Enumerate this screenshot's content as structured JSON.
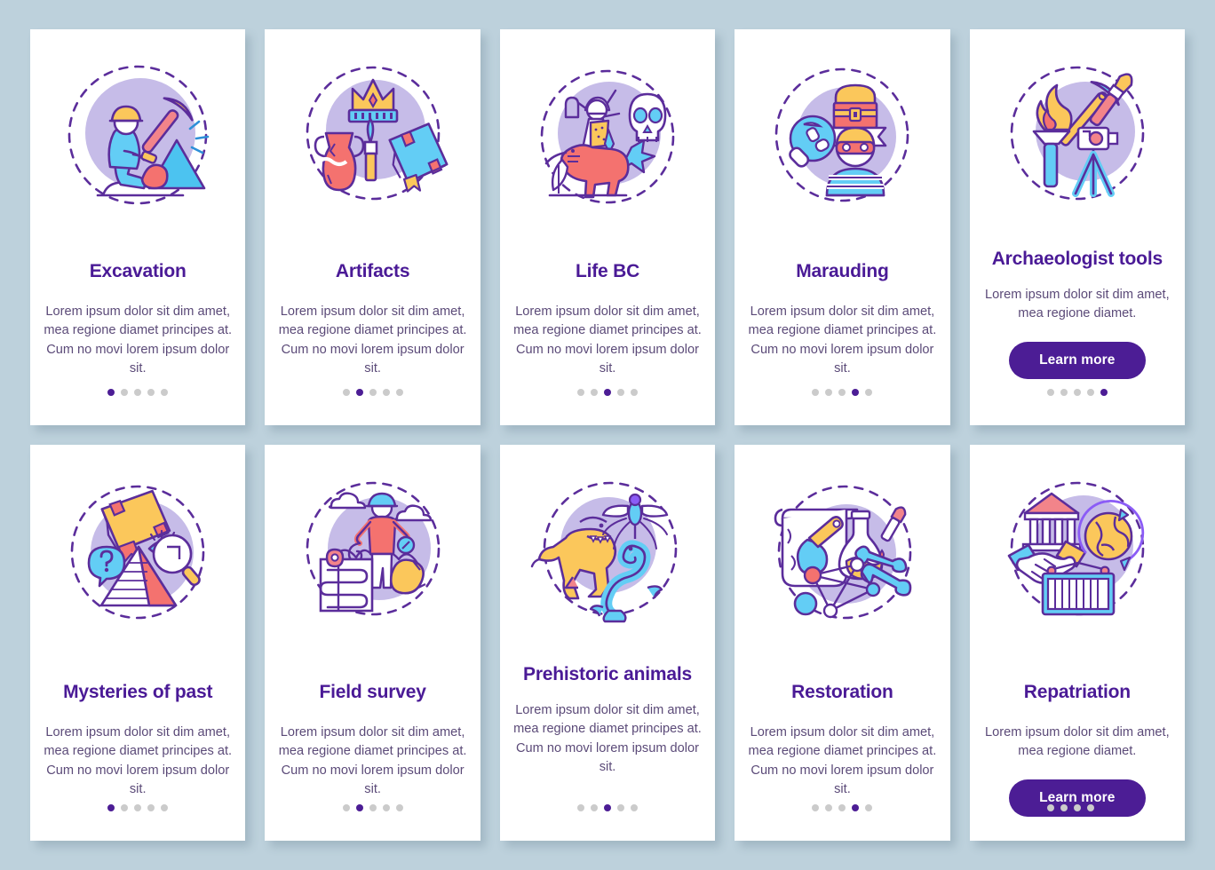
{
  "theme": {
    "background": "#bdd1dc",
    "card_background": "#ffffff",
    "title_color": "#4a1a96",
    "body_color": "#5b4a78",
    "accent": "#4c1d95",
    "dot_inactive": "#cbcbcb",
    "illustration_circle": "#c6bce8"
  },
  "body_text_full": "Lorem ipsum dolor sit dim amet, mea regione diamet principes at. Cum no movi lorem ipsum dolor sit.",
  "body_text_short": "Lorem ipsum dolor sit dim amet, mea regione diamet.",
  "learn_more_label": "Learn more",
  "dot_count": 5,
  "rows": [
    {
      "cards": [
        {
          "title": "Excavation",
          "body": "Lorem ipsum dolor sit dim amet, mea regione diamet principes at. Cum no movi lorem ipsum dolor sit.",
          "illustration": "excavation-illustration",
          "active_dot": 0,
          "has_button": false
        },
        {
          "title": "Artifacts",
          "body": "Lorem ipsum dolor sit dim amet, mea regione diamet principes at. Cum no movi lorem ipsum dolor sit.",
          "illustration": "artifacts-illustration",
          "active_dot": 1,
          "has_button": false
        },
        {
          "title": "Life BC",
          "body": "Lorem ipsum dolor sit dim amet, mea regione diamet principes at. Cum no movi lorem ipsum dolor sit.",
          "illustration": "life-bc-illustration",
          "active_dot": 2,
          "has_button": false
        },
        {
          "title": "Marauding",
          "body": "Lorem ipsum dolor sit dim amet, mea regione diamet principes at. Cum no movi lorem ipsum dolor sit.",
          "illustration": "marauding-illustration",
          "active_dot": 3,
          "has_button": false
        },
        {
          "title": "Archaeologist tools",
          "body": "Lorem ipsum dolor sit dim amet, mea regione diamet.",
          "illustration": "archaeologist-tools-illustration",
          "active_dot": 4,
          "has_button": true,
          "button_label": "Learn more"
        }
      ]
    },
    {
      "cards": [
        {
          "title": "Mysteries of past",
          "body": "Lorem ipsum dolor sit dim amet, mea regione diamet principes at. Cum no movi lorem ipsum dolor sit.",
          "illustration": "mysteries-of-past-illustration",
          "active_dot": 0,
          "has_button": false
        },
        {
          "title": "Field survey",
          "body": "Lorem ipsum dolor sit dim amet, mea regione diamet principes at. Cum no movi lorem ipsum dolor sit.",
          "illustration": "field-survey-illustration",
          "active_dot": 1,
          "has_button": false
        },
        {
          "title": "Prehistoric animals",
          "body": "Lorem ipsum dolor sit dim amet, mea regione diamet principes at. Cum no movi lorem ipsum dolor sit.",
          "illustration": "prehistoric-animals-illustration",
          "active_dot": 2,
          "has_button": false
        },
        {
          "title": "Restoration",
          "body": "Lorem ipsum dolor sit dim amet, mea regione diamet principes at. Cum no movi lorem ipsum dolor sit.",
          "illustration": "restoration-illustration",
          "active_dot": 3,
          "has_button": false
        },
        {
          "title": "Repatriation",
          "body": "Lorem ipsum dolor sit dim amet, mea regione diamet.",
          "illustration": "repatriation-illustration",
          "active_dot": 4,
          "has_button": true,
          "button_label": "Learn more"
        }
      ]
    }
  ]
}
